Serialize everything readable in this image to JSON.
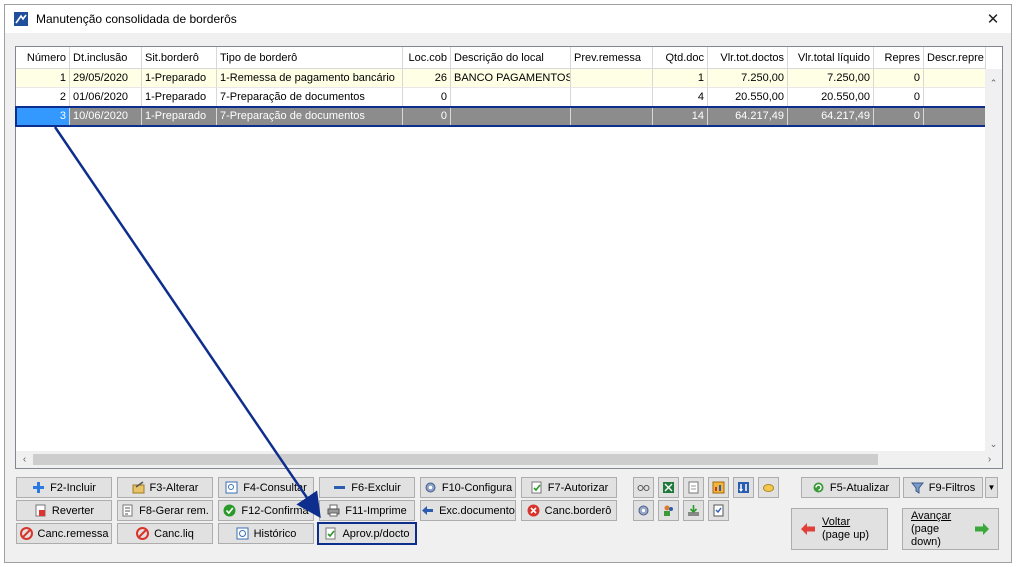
{
  "window": {
    "title": "Manutenção consolidada de borderôs",
    "close_glyph": "✕"
  },
  "grid": {
    "columns": [
      "Número",
      "Dt.inclusão",
      "Sit.borderô",
      "Tipo de borderô",
      "Loc.cob",
      "Descrição do local",
      "Prev.remessa",
      "Qtd.doc",
      "Vlr.tot.doctos",
      "Vlr.total líquido",
      "Repres",
      "Descr.repre"
    ],
    "rows": [
      [
        "1",
        "29/05/2020",
        "1-Preparado",
        "1-Remessa de pagamento bancário",
        "26",
        "BANCO PAGAMENTOS",
        "",
        "1",
        "7.250,00",
        "7.250,00",
        "0",
        ""
      ],
      [
        "2",
        "01/06/2020",
        "1-Preparado",
        "7-Preparação de documentos",
        "0",
        "",
        "",
        "4",
        "20.550,00",
        "20.550,00",
        "0",
        ""
      ],
      [
        "3",
        "10/06/2020",
        "1-Preparado",
        "7-Preparação de documentos",
        "0",
        "",
        "",
        "14",
        "64.217,49",
        "64.217,49",
        "0",
        ""
      ]
    ],
    "selected_row": 3,
    "scroll": {
      "up": "⌃",
      "down": "⌄",
      "left": "‹",
      "right": "›"
    }
  },
  "buttons": {
    "f2": "F2-Incluir",
    "f3": "F3-Alterar",
    "f4": "F4-Consultar",
    "f6": "F6-Excluir",
    "f10": "F10-Configura",
    "f7": "F7-Autorizar",
    "reverter": "Reverter",
    "f8": "F8-Gerar rem.",
    "f12": "F12-Confirma",
    "f11": "F11-Imprime",
    "exc_doc": "Exc.documento",
    "canc_bordero": "Canc.borderô",
    "canc_remessa": "Canc.remessa",
    "canc_liq": "Canc.liq",
    "historico": "Histórico",
    "aprov": "Aprov.p/docto",
    "f5": "F5-Atualizar",
    "f9": "F9-Filtros",
    "voltar_1": "Voltar",
    "voltar_2": "(page up)",
    "avancar_1": "Avançar",
    "avancar_2": "(page down)"
  },
  "colors": {
    "selection_outline": "#0d2e8c",
    "selected_row": "#8c8c8c",
    "highlight_row": "#ffffe6"
  }
}
